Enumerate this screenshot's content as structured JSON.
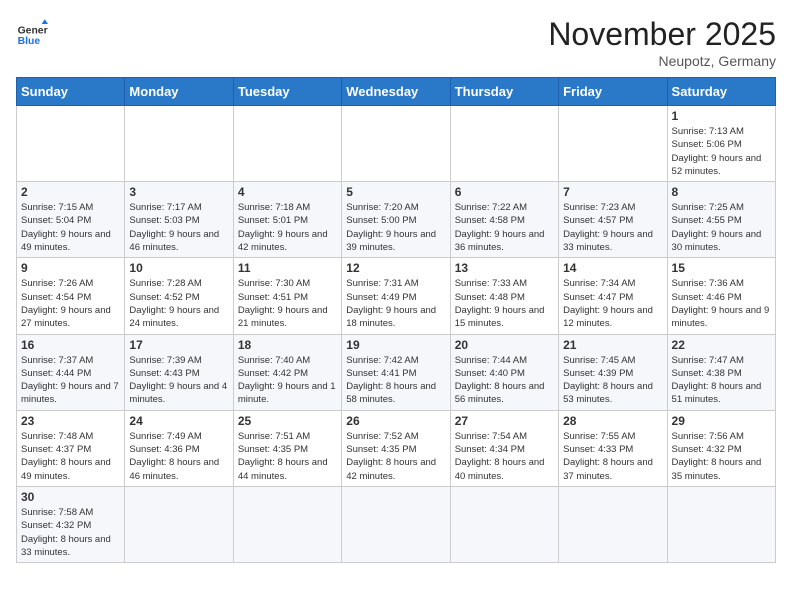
{
  "header": {
    "logo_general": "General",
    "logo_blue": "Blue",
    "month_year": "November 2025",
    "location": "Neupotz, Germany"
  },
  "days_of_week": [
    "Sunday",
    "Monday",
    "Tuesday",
    "Wednesday",
    "Thursday",
    "Friday",
    "Saturday"
  ],
  "weeks": [
    [
      {
        "day": "",
        "info": ""
      },
      {
        "day": "",
        "info": ""
      },
      {
        "day": "",
        "info": ""
      },
      {
        "day": "",
        "info": ""
      },
      {
        "day": "",
        "info": ""
      },
      {
        "day": "",
        "info": ""
      },
      {
        "day": "1",
        "info": "Sunrise: 7:13 AM\nSunset: 5:06 PM\nDaylight: 9 hours and 52 minutes."
      }
    ],
    [
      {
        "day": "2",
        "info": "Sunrise: 7:15 AM\nSunset: 5:04 PM\nDaylight: 9 hours and 49 minutes."
      },
      {
        "day": "3",
        "info": "Sunrise: 7:17 AM\nSunset: 5:03 PM\nDaylight: 9 hours and 46 minutes."
      },
      {
        "day": "4",
        "info": "Sunrise: 7:18 AM\nSunset: 5:01 PM\nDaylight: 9 hours and 42 minutes."
      },
      {
        "day": "5",
        "info": "Sunrise: 7:20 AM\nSunset: 5:00 PM\nDaylight: 9 hours and 39 minutes."
      },
      {
        "day": "6",
        "info": "Sunrise: 7:22 AM\nSunset: 4:58 PM\nDaylight: 9 hours and 36 minutes."
      },
      {
        "day": "7",
        "info": "Sunrise: 7:23 AM\nSunset: 4:57 PM\nDaylight: 9 hours and 33 minutes."
      },
      {
        "day": "8",
        "info": "Sunrise: 7:25 AM\nSunset: 4:55 PM\nDaylight: 9 hours and 30 minutes."
      }
    ],
    [
      {
        "day": "9",
        "info": "Sunrise: 7:26 AM\nSunset: 4:54 PM\nDaylight: 9 hours and 27 minutes."
      },
      {
        "day": "10",
        "info": "Sunrise: 7:28 AM\nSunset: 4:52 PM\nDaylight: 9 hours and 24 minutes."
      },
      {
        "day": "11",
        "info": "Sunrise: 7:30 AM\nSunset: 4:51 PM\nDaylight: 9 hours and 21 minutes."
      },
      {
        "day": "12",
        "info": "Sunrise: 7:31 AM\nSunset: 4:49 PM\nDaylight: 9 hours and 18 minutes."
      },
      {
        "day": "13",
        "info": "Sunrise: 7:33 AM\nSunset: 4:48 PM\nDaylight: 9 hours and 15 minutes."
      },
      {
        "day": "14",
        "info": "Sunrise: 7:34 AM\nSunset: 4:47 PM\nDaylight: 9 hours and 12 minutes."
      },
      {
        "day": "15",
        "info": "Sunrise: 7:36 AM\nSunset: 4:46 PM\nDaylight: 9 hours and 9 minutes."
      }
    ],
    [
      {
        "day": "16",
        "info": "Sunrise: 7:37 AM\nSunset: 4:44 PM\nDaylight: 9 hours and 7 minutes."
      },
      {
        "day": "17",
        "info": "Sunrise: 7:39 AM\nSunset: 4:43 PM\nDaylight: 9 hours and 4 minutes."
      },
      {
        "day": "18",
        "info": "Sunrise: 7:40 AM\nSunset: 4:42 PM\nDaylight: 9 hours and 1 minute."
      },
      {
        "day": "19",
        "info": "Sunrise: 7:42 AM\nSunset: 4:41 PM\nDaylight: 8 hours and 58 minutes."
      },
      {
        "day": "20",
        "info": "Sunrise: 7:44 AM\nSunset: 4:40 PM\nDaylight: 8 hours and 56 minutes."
      },
      {
        "day": "21",
        "info": "Sunrise: 7:45 AM\nSunset: 4:39 PM\nDaylight: 8 hours and 53 minutes."
      },
      {
        "day": "22",
        "info": "Sunrise: 7:47 AM\nSunset: 4:38 PM\nDaylight: 8 hours and 51 minutes."
      }
    ],
    [
      {
        "day": "23",
        "info": "Sunrise: 7:48 AM\nSunset: 4:37 PM\nDaylight: 8 hours and 49 minutes."
      },
      {
        "day": "24",
        "info": "Sunrise: 7:49 AM\nSunset: 4:36 PM\nDaylight: 8 hours and 46 minutes."
      },
      {
        "day": "25",
        "info": "Sunrise: 7:51 AM\nSunset: 4:35 PM\nDaylight: 8 hours and 44 minutes."
      },
      {
        "day": "26",
        "info": "Sunrise: 7:52 AM\nSunset: 4:35 PM\nDaylight: 8 hours and 42 minutes."
      },
      {
        "day": "27",
        "info": "Sunrise: 7:54 AM\nSunset: 4:34 PM\nDaylight: 8 hours and 40 minutes."
      },
      {
        "day": "28",
        "info": "Sunrise: 7:55 AM\nSunset: 4:33 PM\nDaylight: 8 hours and 37 minutes."
      },
      {
        "day": "29",
        "info": "Sunrise: 7:56 AM\nSunset: 4:32 PM\nDaylight: 8 hours and 35 minutes."
      }
    ],
    [
      {
        "day": "30",
        "info": "Sunrise: 7:58 AM\nSunset: 4:32 PM\nDaylight: 8 hours and 33 minutes."
      },
      {
        "day": "",
        "info": ""
      },
      {
        "day": "",
        "info": ""
      },
      {
        "day": "",
        "info": ""
      },
      {
        "day": "",
        "info": ""
      },
      {
        "day": "",
        "info": ""
      },
      {
        "day": "",
        "info": ""
      }
    ]
  ]
}
